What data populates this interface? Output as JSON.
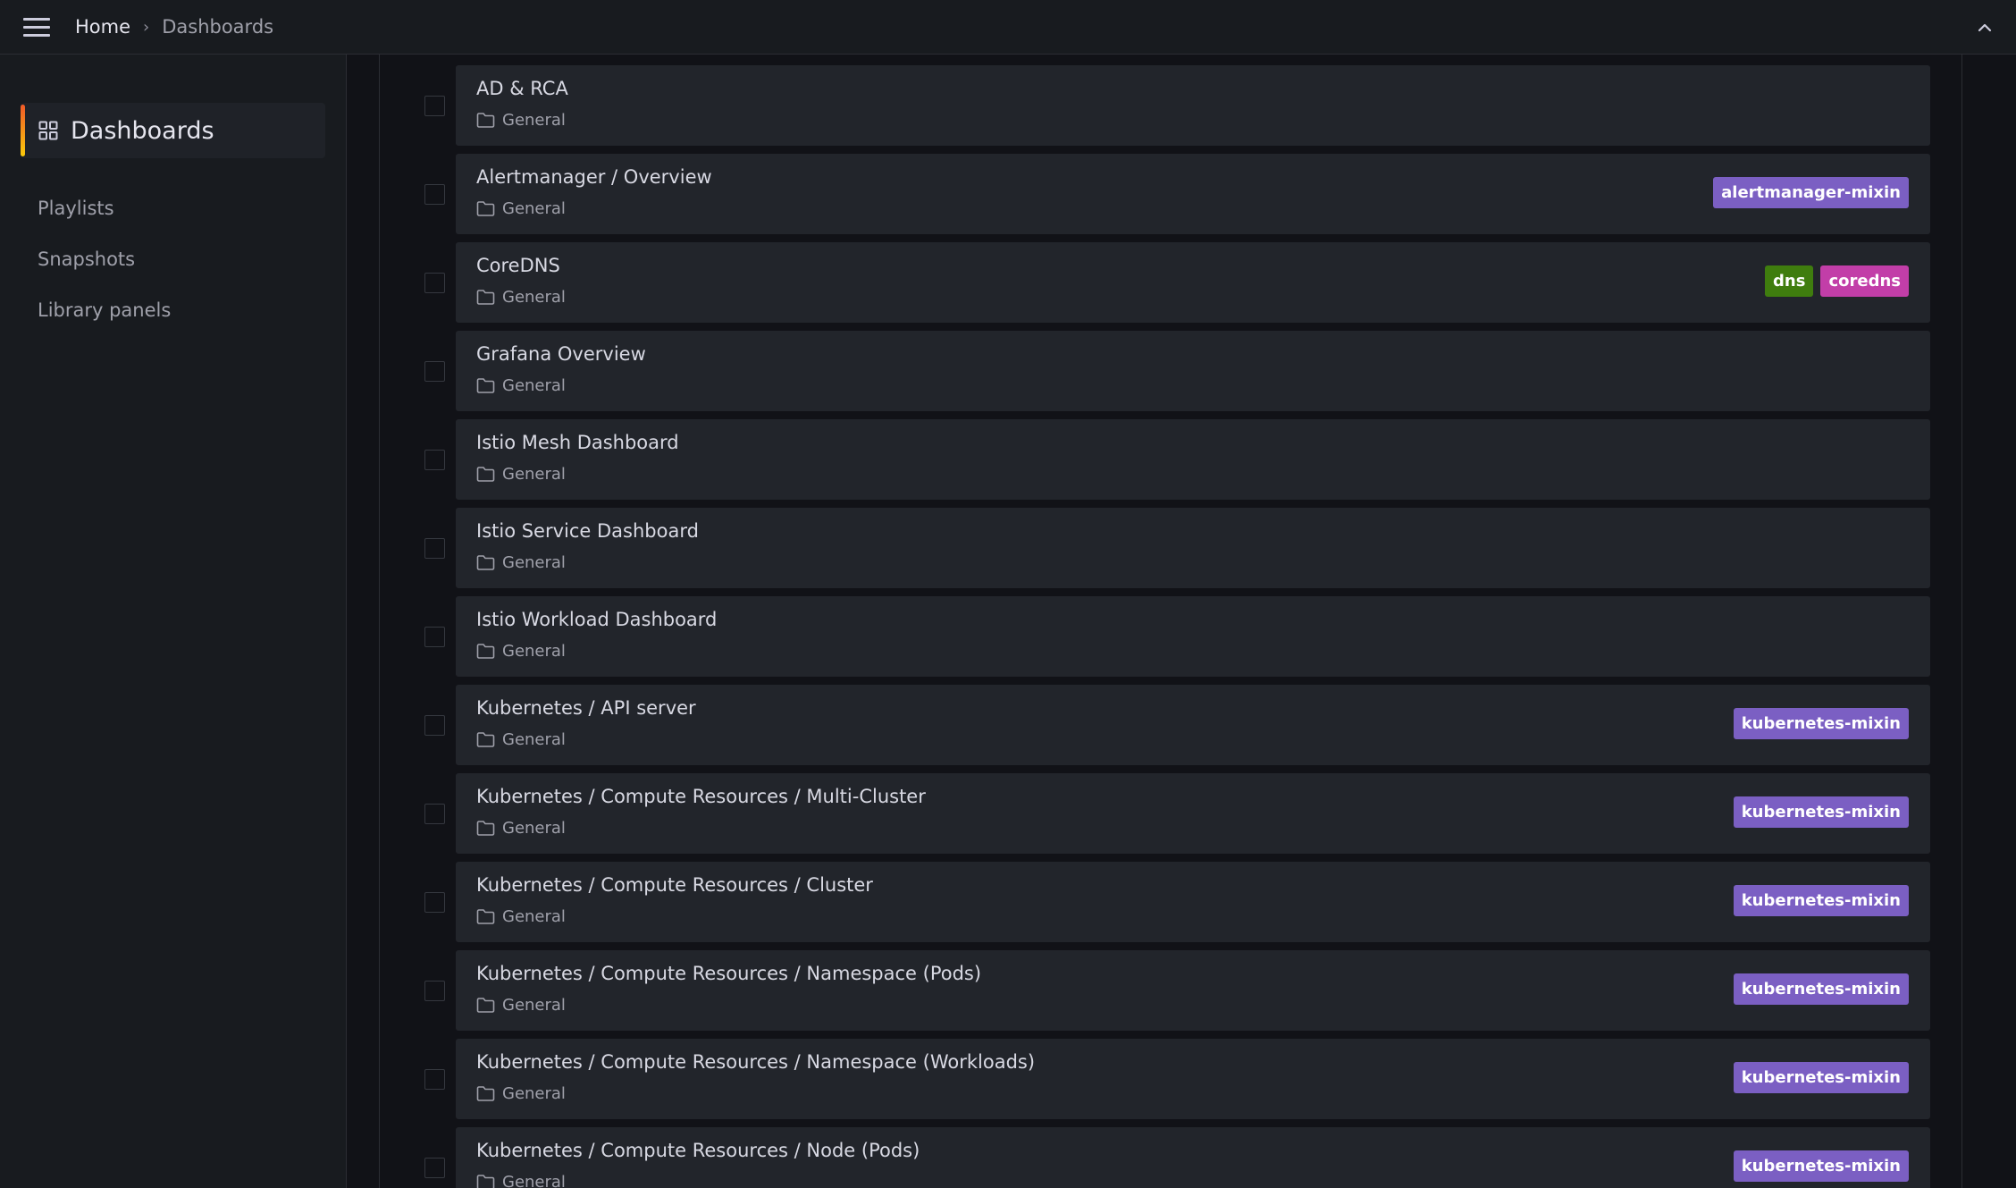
{
  "header": {
    "breadcrumb": {
      "home": "Home",
      "separator": "›",
      "current": "Dashboards"
    },
    "menu_icon": "hamburger-menu-icon",
    "collapse_icon": "chevron-up-icon"
  },
  "sidebar": {
    "active": {
      "label": "Dashboards",
      "icon": "apps-grid-icon"
    },
    "items": [
      {
        "label": "Playlists"
      },
      {
        "label": "Snapshots"
      },
      {
        "label": "Library panels"
      }
    ]
  },
  "colors": {
    "tag_mixin": "#7b5fc3",
    "tag_dns": "#3f7d0e",
    "tag_coredns": "#c23ea8",
    "accent": "#f05a28"
  },
  "dashboards": [
    {
      "title": "AD & RCA",
      "folder": "General",
      "tags": []
    },
    {
      "title": "Alertmanager / Overview",
      "folder": "General",
      "tags": [
        {
          "label": "alertmanager-mixin",
          "color": "#7b5fc3"
        }
      ]
    },
    {
      "title": "CoreDNS",
      "folder": "General",
      "tags": [
        {
          "label": "dns",
          "color": "#3f7d0e"
        },
        {
          "label": "coredns",
          "color": "#c23ea8"
        }
      ]
    },
    {
      "title": "Grafana Overview",
      "folder": "General",
      "tags": []
    },
    {
      "title": "Istio Mesh Dashboard",
      "folder": "General",
      "tags": []
    },
    {
      "title": "Istio Service Dashboard",
      "folder": "General",
      "tags": []
    },
    {
      "title": "Istio Workload Dashboard",
      "folder": "General",
      "tags": []
    },
    {
      "title": "Kubernetes / API server",
      "folder": "General",
      "tags": [
        {
          "label": "kubernetes-mixin",
          "color": "#7b5fc3"
        }
      ]
    },
    {
      "title": "Kubernetes / Compute Resources / Multi-Cluster",
      "folder": "General",
      "tags": [
        {
          "label": "kubernetes-mixin",
          "color": "#7b5fc3"
        }
      ]
    },
    {
      "title": "Kubernetes / Compute Resources / Cluster",
      "folder": "General",
      "tags": [
        {
          "label": "kubernetes-mixin",
          "color": "#7b5fc3"
        }
      ]
    },
    {
      "title": "Kubernetes / Compute Resources / Namespace (Pods)",
      "folder": "General",
      "tags": [
        {
          "label": "kubernetes-mixin",
          "color": "#7b5fc3"
        }
      ]
    },
    {
      "title": "Kubernetes / Compute Resources / Namespace (Workloads)",
      "folder": "General",
      "tags": [
        {
          "label": "kubernetes-mixin",
          "color": "#7b5fc3"
        }
      ]
    },
    {
      "title": "Kubernetes / Compute Resources / Node (Pods)",
      "folder": "General",
      "tags": [
        {
          "label": "kubernetes-mixin",
          "color": "#7b5fc3"
        }
      ]
    }
  ]
}
